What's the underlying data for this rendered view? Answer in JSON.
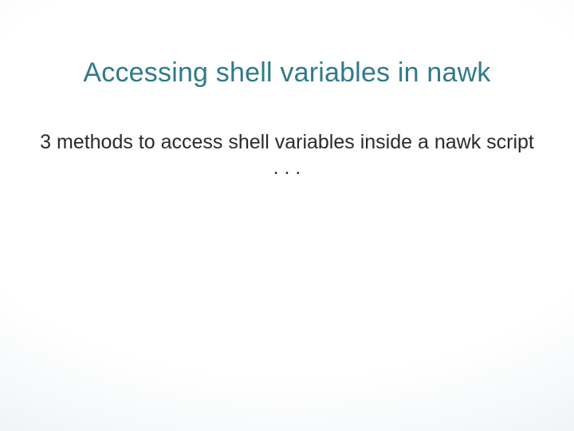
{
  "slide": {
    "title": "Accessing shell variables in nawk",
    "body": "3 methods to access shell variables inside a nawk script . . ."
  }
}
